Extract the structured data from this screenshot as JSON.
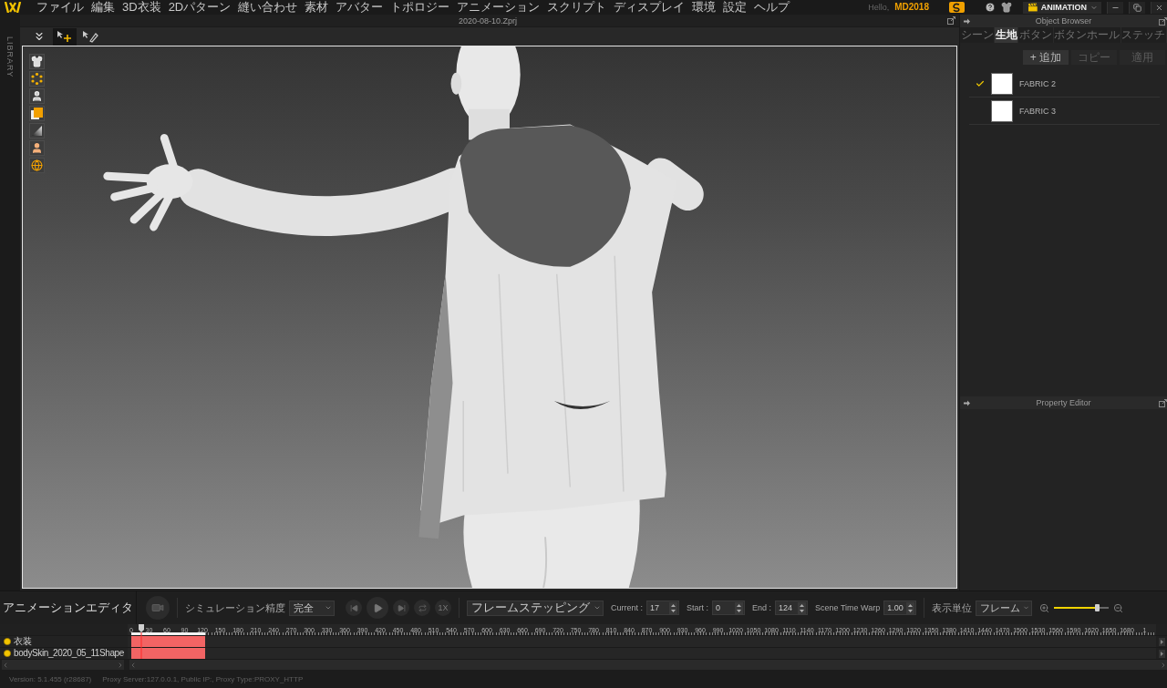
{
  "menu_bar": {
    "items": [
      "ファイル",
      "編集",
      "3D衣装",
      "2Dパターン",
      "縫い合わせ",
      "素材",
      "アバター",
      "トポロジー",
      "アニメーション",
      "スクリプト",
      "ディスプレイ",
      "環境",
      "設定",
      "ヘルプ"
    ],
    "greeting": "Hello,",
    "user": "MD2018",
    "mode": "ANIMATION"
  },
  "library_tab": {
    "label": "LIBRARY"
  },
  "document": {
    "title": "2020-08-10.Zprj"
  },
  "toolbar": {
    "tools": [
      {
        "selected": false
      },
      {
        "selected": true
      },
      {
        "selected": false
      }
    ]
  },
  "object_browser": {
    "title": "Object Browser",
    "tabs": [
      {
        "label": "シーン",
        "selected": false
      },
      {
        "label": "生地",
        "selected": true
      },
      {
        "label": "ボタン",
        "selected": false
      },
      {
        "label": "ボタンホール",
        "selected": false
      },
      {
        "label": "ステッチ",
        "selected": false
      }
    ],
    "actions": [
      {
        "label": "+ 追加",
        "disabled": false
      },
      {
        "label": "コピー",
        "disabled": true
      },
      {
        "label": "適用",
        "disabled": true
      }
    ],
    "fabrics": [
      {
        "name": "FABRIC 2",
        "checked": true
      },
      {
        "name": "FABRIC 3",
        "checked": false
      }
    ]
  },
  "property_editor": {
    "title": "Property Editor"
  },
  "animation_editor": {
    "title": "アニメーションエディタ",
    "simulation_label": "シミュレーション精度",
    "simulation_value": "完全",
    "speed": "1X",
    "stepping": "フレームステッピング",
    "current": {
      "label": "Current :",
      "value": "17"
    },
    "start": {
      "label": "Start :",
      "value": "0"
    },
    "end": {
      "label": "End :",
      "value": "124"
    },
    "time_warp": {
      "label": "Scene Time Warp",
      "value": "1.00"
    },
    "unit_label": "表示単位",
    "unit_value": "フレーム",
    "zoom": {
      "level": 0.78
    }
  },
  "timeline": {
    "ruler": [
      "0",
      "30",
      "60",
      "90",
      "120",
      "150",
      "180",
      "210",
      "240",
      "270",
      "300",
      "330",
      "360",
      "390",
      "420",
      "450",
      "480",
      "510",
      "540",
      "570",
      "600",
      "630",
      "660",
      "690",
      "720",
      "750",
      "780",
      "810",
      "840",
      "870",
      "900",
      "930",
      "960",
      "990",
      "1020",
      "1050",
      "1080",
      "1110",
      "1140",
      "1170",
      "1200",
      "1230",
      "1260",
      "1290",
      "1320",
      "1350",
      "1380",
      "1410",
      "1440",
      "1470",
      "1500",
      "1530",
      "1560",
      "1590",
      "1620",
      "1650",
      "1680",
      "1"
    ],
    "tracks": [
      {
        "name": "衣装"
      },
      {
        "name": "bodySkin_2020_05_11Shape"
      }
    ]
  },
  "status_bar": {
    "version": "Version: 5.1.455 (r28687)",
    "proxy": "Proxy Server:127.0.0.1, Public IP:, Proxy Type:PROXY_HTTP"
  }
}
